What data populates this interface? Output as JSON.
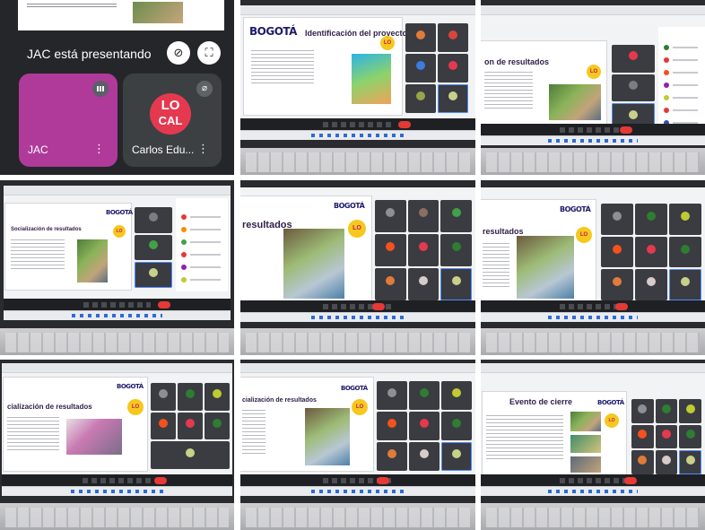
{
  "phone_panel": {
    "presenting_text": "JAC está presentando",
    "tiles": [
      {
        "name": "JAC"
      },
      {
        "name": "Carlos Edu..."
      }
    ],
    "logo_lo": "LO",
    "logo_cal": "CAL"
  },
  "slides": {
    "brand": "BOGOTÁ",
    "badge": "LO",
    "title_identificacion": "Identificación del proyecto",
    "title_socializacion": "Socialización de resultados",
    "title_resultados": "resultados",
    "title_evento": "Evento de cierre",
    "title_on_resultados": "on de resultados",
    "title_cializacion": "cialización de resultados"
  },
  "colors": {
    "meet_dark": "#202124",
    "end_call": "#e53935",
    "jac_tile": "#b03a9a",
    "badge_yellow": "#f6c81e",
    "brand_navy": "#1d1b6b"
  }
}
